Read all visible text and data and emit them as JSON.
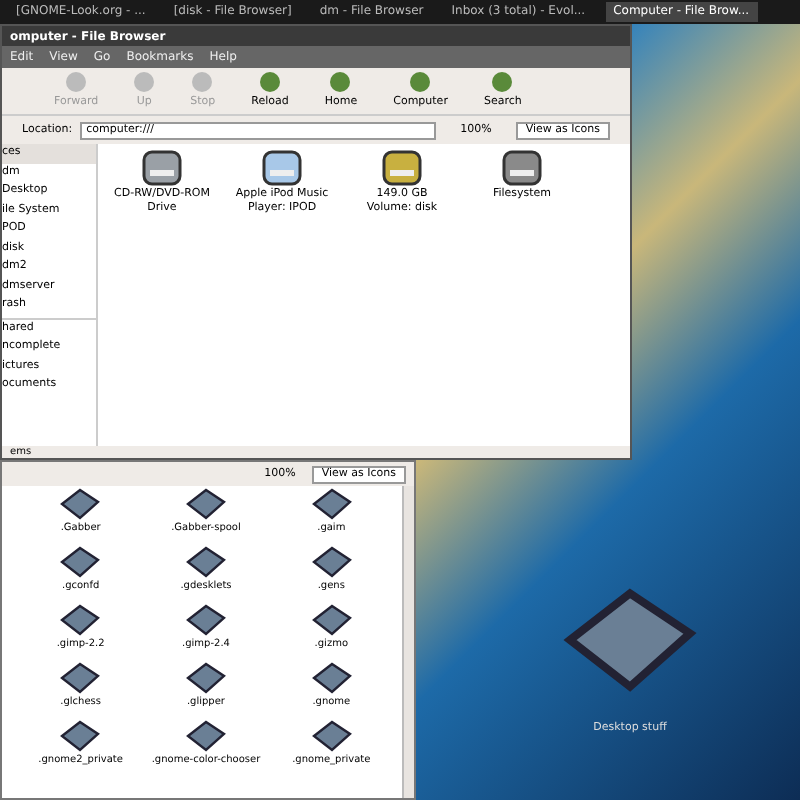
{
  "taskbar": {
    "items": [
      {
        "label": "[GNOME-Look.org - ...",
        "selected": false
      },
      {
        "label": "[disk - File Browser]",
        "selected": false
      },
      {
        "label": "dm - File Browser",
        "selected": false
      },
      {
        "label": "Inbox (3 total) - Evol...",
        "selected": false
      },
      {
        "label": "Computer - File Brow...",
        "selected": true
      }
    ]
  },
  "front_window": {
    "title": "omputer - File Browser",
    "menu": [
      "Edit",
      "View",
      "Go",
      "Bookmarks",
      "Help"
    ],
    "toolbar": [
      {
        "label": "Forward",
        "disabled": true
      },
      {
        "label": "Up",
        "disabled": true
      },
      {
        "label": "Stop",
        "disabled": true
      },
      {
        "label": "Reload",
        "disabled": false
      },
      {
        "label": "Home",
        "disabled": false
      },
      {
        "label": "Computer",
        "disabled": false
      },
      {
        "label": "Search",
        "disabled": false
      }
    ],
    "location_label": "Location:",
    "location": "computer:///",
    "zoom": "100%",
    "view": "View as Icons",
    "sidebar": {
      "header": "ces",
      "groups": [
        [
          "dm",
          "Desktop",
          "ile System",
          "POD",
          "disk",
          "dm2",
          "dmserver",
          "rash"
        ],
        [
          "hared",
          "ncomplete",
          "ictures",
          "ocuments"
        ]
      ]
    },
    "items": [
      {
        "label": "CD-RW/DVD-ROM Drive",
        "kind": "optical"
      },
      {
        "label": "Apple iPod Music Player: IPOD",
        "kind": "ipod"
      },
      {
        "label": "149.0 GB Volume: disk",
        "kind": "volume"
      },
      {
        "label": "Filesystem",
        "kind": "drive"
      }
    ],
    "status": "ems"
  },
  "back_window": {
    "zoom": "100%",
    "view": "View as Icons",
    "items": [
      ".Gabber",
      ".Gabber-spool",
      ".gaim",
      ".gconfd",
      ".gdesklets",
      ".gens",
      ".gimp-2.2",
      ".gimp-2.4",
      ".gizmo",
      ".glchess",
      ".glipper",
      ".gnome",
      ".gnome2_private",
      ".gnome-color-chooser",
      ".gnome_private"
    ]
  },
  "desktop": {
    "icon_label": "Desktop stuff"
  }
}
